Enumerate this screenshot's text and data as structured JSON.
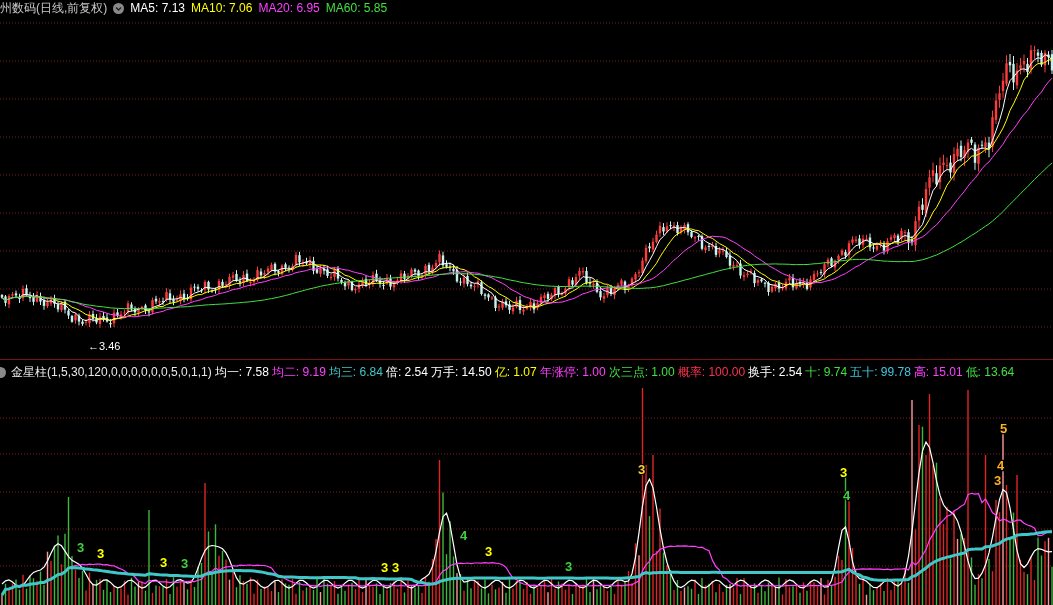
{
  "price_panel": {
    "title": "州数码(日线,前复权)",
    "ma_legend": [
      {
        "text": "MA5: 7.13",
        "color": "#ffffff"
      },
      {
        "text": "MA10: 7.06",
        "color": "#ffff00"
      },
      {
        "text": "MA20: 6.95",
        "color": "#ff40ff"
      },
      {
        "text": "MA60: 5.85",
        "color": "#40e040"
      }
    ],
    "low_label": "←3.46"
  },
  "indicator_panel": {
    "title": "金星柱(1,5,30,120,0,0,0,0,0,0,5,0,1,1)",
    "legend": [
      {
        "text": "均一: 7.58",
        "color": "#ffffff"
      },
      {
        "text": "均二: 9.19",
        "color": "#ff40ff"
      },
      {
        "text": "均三: 6.84",
        "color": "#40c8c8"
      },
      {
        "text": "倍: 2.54",
        "color": "#ffffff"
      },
      {
        "text": "万手: 14.50",
        "color": "#ffffff"
      },
      {
        "text": "亿: 1.07",
        "color": "#ffff00"
      },
      {
        "text": "年涨停: 1.00",
        "color": "#ff40ff"
      },
      {
        "text": "次三点: 1.00",
        "color": "#40e040"
      },
      {
        "text": "概率: 100.00",
        "color": "#ff3050"
      },
      {
        "text": "换手: 2.54",
        "color": "#ffffff"
      },
      {
        "text": "十: 9.74",
        "color": "#40e040"
      },
      {
        "text": "五十: 99.78",
        "color": "#40c8e0"
      },
      {
        "text": "高: 15.01",
        "color": "#ff40ff"
      },
      {
        "text": "低: 13.64",
        "color": "#40e040"
      }
    ],
    "signal_marks": [
      {
        "text": "3",
        "color": "#40d040"
      },
      {
        "text": "3",
        "color": "#ffff00"
      },
      {
        "text": "3",
        "color": "#ffff00"
      },
      {
        "text": "3",
        "color": "#40d040"
      },
      {
        "text": "3",
        "color": "#ffff00"
      },
      {
        "text": "3",
        "color": "#ffff00"
      },
      {
        "text": "4",
        "color": "#40d040"
      },
      {
        "text": "3",
        "color": "#ffff00"
      },
      {
        "text": "3",
        "color": "#40d040"
      },
      {
        "text": "3",
        "color": "#ffd030"
      },
      {
        "text": "3",
        "color": "#ffff00"
      },
      {
        "text": "4",
        "color": "#40d040"
      },
      {
        "text": "5",
        "color": "#ffb020"
      },
      {
        "text": "4",
        "color": "#ffb020"
      },
      {
        "text": "3",
        "color": "#ffb020"
      }
    ]
  }
}
